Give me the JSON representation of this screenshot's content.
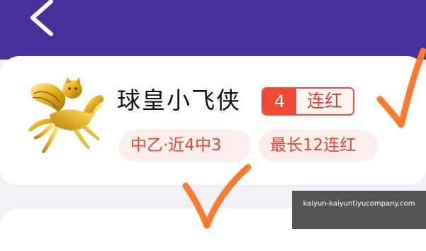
{
  "header": {
    "back_icon": "chevron-left-icon",
    "background_color": "#46309a"
  },
  "profile": {
    "avatar_icon": "winged-horse-icon",
    "name": "球皇小飞侠",
    "streak_badge": {
      "number": "4",
      "label": "连红"
    },
    "tags": [
      {
        "text": "中乙·近4中3"
      },
      {
        "text": "最长12连红"
      }
    ]
  },
  "annotations": {
    "checkmark_color": "#ff7a2e",
    "checkmarks": [
      "checkmark-icon",
      "checkmark-icon"
    ]
  },
  "watermark": {
    "line1": "",
    "line2": "kaiyun-kaiyuntiyucompany.com"
  },
  "colors": {
    "accent_red": "#ee4a31",
    "tag_bg": "#fdeeee",
    "page_bg": "#f2f1f6"
  }
}
